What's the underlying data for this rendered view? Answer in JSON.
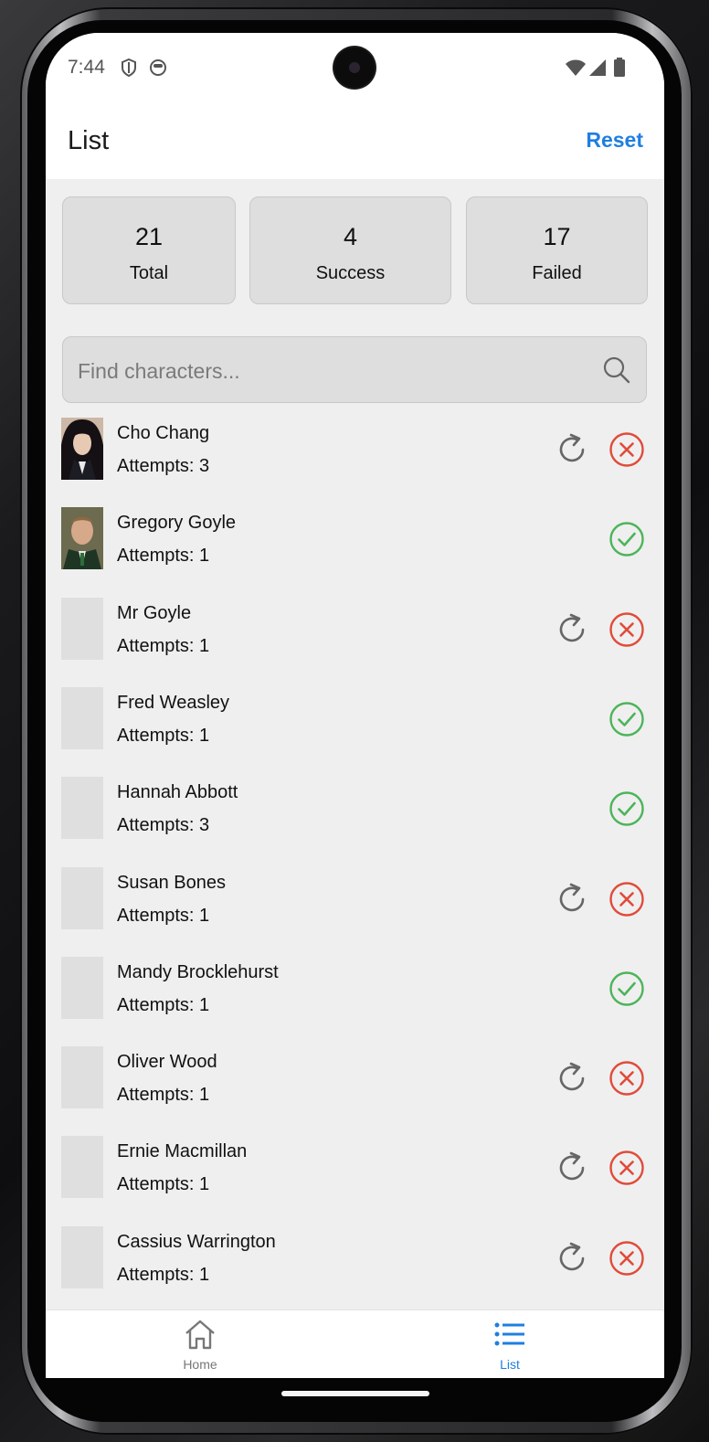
{
  "status_bar": {
    "time": "7:44",
    "icons": [
      "shield-icon",
      "face-icon",
      "wifi-icon",
      "signal-icon",
      "battery-icon"
    ]
  },
  "app_bar": {
    "title": "List",
    "reset_label": "Reset",
    "accent_color": "#1f7fe0"
  },
  "stats": {
    "total": {
      "value": "21",
      "label": "Total"
    },
    "success": {
      "value": "4",
      "label": "Success"
    },
    "failed": {
      "value": "17",
      "label": "Failed"
    }
  },
  "search": {
    "placeholder": "Find characters...",
    "value": ""
  },
  "characters": [
    {
      "name": "Cho Chang",
      "attempts": "Attempts: 3",
      "status": "failed",
      "has_photo": true
    },
    {
      "name": "Gregory Goyle",
      "attempts": "Attempts: 1",
      "status": "success",
      "has_photo": true
    },
    {
      "name": "Mr Goyle",
      "attempts": "Attempts: 1",
      "status": "failed",
      "has_photo": false
    },
    {
      "name": "Fred Weasley",
      "attempts": "Attempts: 1",
      "status": "success",
      "has_photo": false
    },
    {
      "name": "Hannah Abbott",
      "attempts": "Attempts: 3",
      "status": "success",
      "has_photo": false
    },
    {
      "name": "Susan Bones",
      "attempts": "Attempts: 1",
      "status": "failed",
      "has_photo": false
    },
    {
      "name": "Mandy Brocklehurst",
      "attempts": "Attempts: 1",
      "status": "success",
      "has_photo": false
    },
    {
      "name": "Oliver Wood",
      "attempts": "Attempts: 1",
      "status": "failed",
      "has_photo": false
    },
    {
      "name": "Ernie Macmillan",
      "attempts": "Attempts: 1",
      "status": "failed",
      "has_photo": false
    },
    {
      "name": "Cassius Warrington",
      "attempts": "Attempts: 1",
      "status": "failed",
      "has_photo": false
    }
  ],
  "colors": {
    "success": "#4cb45a",
    "failed": "#e04b3a",
    "retry": "#666666",
    "tab_inactive": "#777777",
    "tab_active": "#1f7fe0"
  },
  "tab_bar": {
    "tabs": [
      {
        "label": "Home",
        "icon": "home-icon",
        "active": false
      },
      {
        "label": "List",
        "icon": "list-icon",
        "active": true
      }
    ]
  }
}
